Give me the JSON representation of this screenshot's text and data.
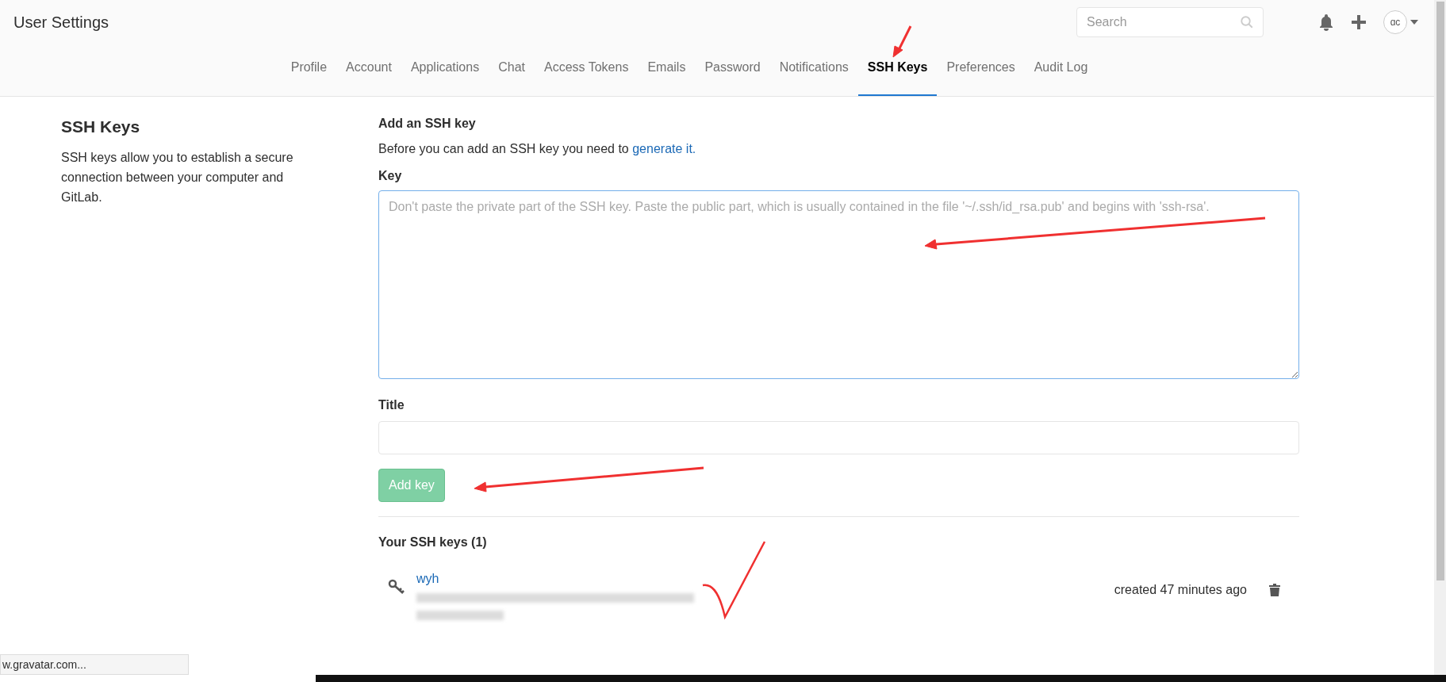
{
  "header": {
    "title": "User Settings",
    "search": {
      "placeholder": "Search"
    },
    "avatar_initials": "ɑϲ"
  },
  "tabs": [
    {
      "label": "Profile",
      "selected": false
    },
    {
      "label": "Account",
      "selected": false
    },
    {
      "label": "Applications",
      "selected": false
    },
    {
      "label": "Chat",
      "selected": false
    },
    {
      "label": "Access Tokens",
      "selected": false
    },
    {
      "label": "Emails",
      "selected": false
    },
    {
      "label": "Password",
      "selected": false
    },
    {
      "label": "Notifications",
      "selected": false
    },
    {
      "label": "SSH Keys",
      "selected": true
    },
    {
      "label": "Preferences",
      "selected": false
    },
    {
      "label": "Audit Log",
      "selected": false
    }
  ],
  "intro": {
    "heading": "SSH Keys",
    "text": "SSH keys allow you to establish a secure connection between your computer and GitLab."
  },
  "form": {
    "heading": "Add an SSH key",
    "note": "Before you can add an SSH key you need to",
    "note_link": "generate it.",
    "key_label": "Key",
    "key_placeholder": "Don't paste the private part of the SSH key. Paste the public part, which is usually contained in the file '~/.ssh/id_rsa.pub' and begins with 'ssh-rsa'.",
    "title_label": "Title",
    "submit": {
      "label": "Add key",
      "disabled": true
    }
  },
  "keys": {
    "heading": "Your SSH keys (1)",
    "items": [
      {
        "title": "wyh",
        "created": "created 47 minutes ago"
      }
    ]
  },
  "status_bar": {
    "text": "w.gravatar.com..."
  }
}
